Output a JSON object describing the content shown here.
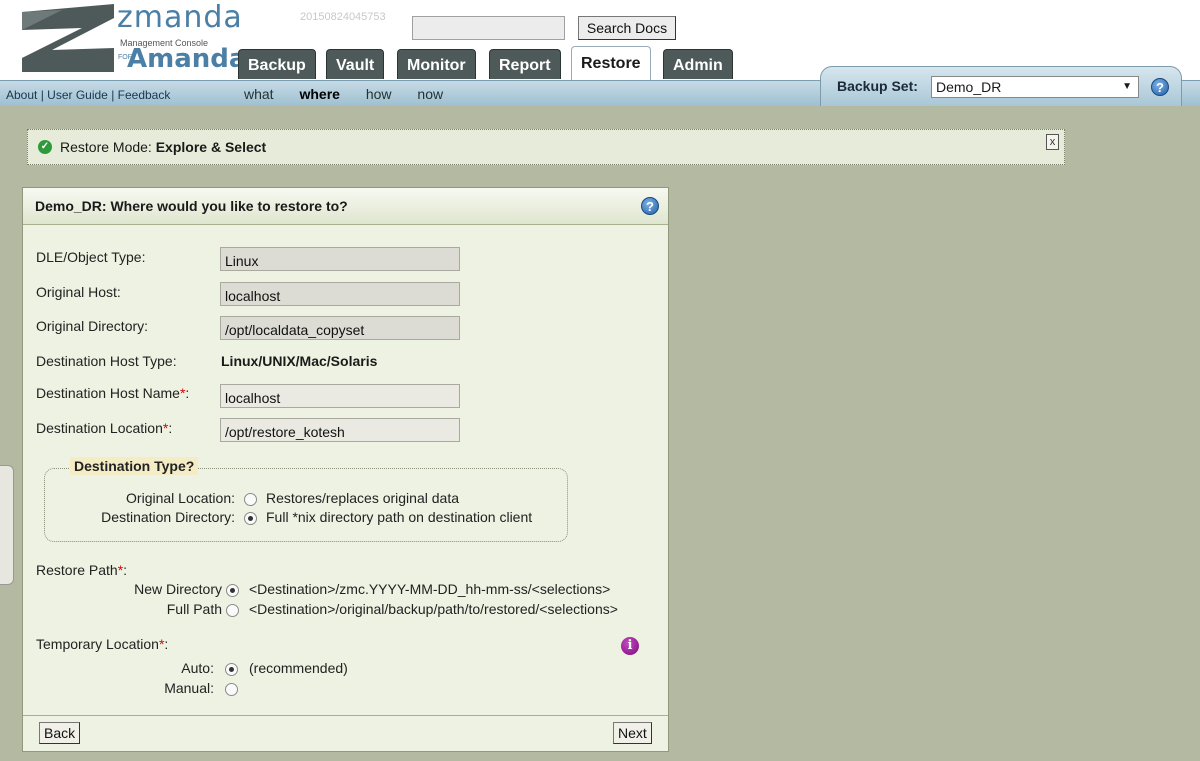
{
  "brand": {
    "name": "zmanda",
    "subtitle": "Management Console",
    "for": "FOR",
    "product": "Amanda"
  },
  "build_id": "20150824045753",
  "search": {
    "value": "",
    "button_label": "Search Docs"
  },
  "tabs": [
    {
      "label": "Backup",
      "active": false
    },
    {
      "label": "Vault",
      "active": false
    },
    {
      "label": "Monitor",
      "active": false
    },
    {
      "label": "Report",
      "active": false
    },
    {
      "label": "Restore",
      "active": true
    },
    {
      "label": "Admin",
      "active": false
    }
  ],
  "links": {
    "about": "About",
    "sep1": " | ",
    "user_guide": "User Guide",
    "sep2": " | ",
    "feedback": "Feedback"
  },
  "wizard_steps": [
    {
      "label": "what",
      "current": false
    },
    {
      "label": "where",
      "current": true
    },
    {
      "label": "how",
      "current": false
    },
    {
      "label": "now",
      "current": false
    }
  ],
  "backup_set": {
    "label": "Backup Set:",
    "value": "Demo_DR"
  },
  "mode": {
    "prefix": "Restore Mode:",
    "value": "Explore & Select",
    "close_label": "x"
  },
  "panel": {
    "title": "Demo_DR: Where would you like to restore to?",
    "fields": {
      "dle_type": {
        "label": "DLE/Object Type:",
        "value": "Linux"
      },
      "orig_host": {
        "label": "Original Host:",
        "value": "localhost"
      },
      "orig_dir": {
        "label": "Original Directory:",
        "value": "/opt/localdata_copyset"
      },
      "dest_host_type": {
        "label": "Destination Host Type:",
        "value": "Linux/UNIX/Mac/Solaris"
      },
      "dest_host_name": {
        "label": "Destination Host Name",
        "value": "localhost"
      },
      "dest_location": {
        "label": "Destination Location",
        "value": "/opt/restore_kotesh"
      }
    },
    "required_mark": "*",
    "colon": ":",
    "destination_type": {
      "legend": "Destination Type?",
      "options": [
        {
          "label": "Original Location:",
          "desc": "Restores/replaces original data",
          "checked": false
        },
        {
          "label": "Destination Directory:",
          "desc": "Full *nix directory path on destination client",
          "checked": true
        }
      ]
    },
    "restore_path": {
      "label": "Restore Path",
      "options": [
        {
          "label": "New Directory",
          "desc": "<Destination>/zmc.YYYY-MM-DD_hh-mm-ss/<selections>",
          "checked": true
        },
        {
          "label": "Full Path",
          "desc": "<Destination>/original/backup/path/to/restored/<selections>",
          "checked": false
        }
      ]
    },
    "temp_location": {
      "label": "Temporary Location",
      "options": [
        {
          "label": "Auto:",
          "desc": "(recommended)",
          "checked": true
        },
        {
          "label": "Manual:",
          "desc": "",
          "checked": false
        }
      ]
    },
    "back_label": "Back",
    "next_label": "Next"
  }
}
